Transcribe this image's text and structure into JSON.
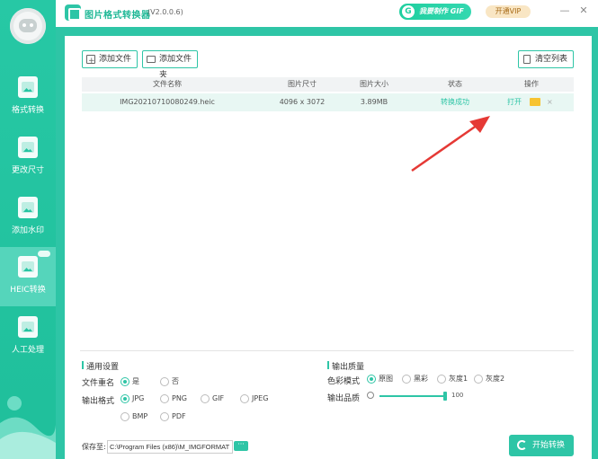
{
  "app": {
    "title": "图片格式转换器",
    "version": "(V2.0.0.6)"
  },
  "titlebar": {
    "gif_label": "我要制作 GIF",
    "gif_icon": "G",
    "vip_label": "开通VIP",
    "minimize": "—",
    "close": "✕"
  },
  "sidebar": {
    "items": [
      {
        "label": "格式转换",
        "icon": "format-convert-icon"
      },
      {
        "label": "更改尺寸",
        "icon": "resize-icon"
      },
      {
        "label": "添加水印",
        "icon": "watermark-icon"
      },
      {
        "label": "HEIC转换",
        "icon": "heic-icon",
        "active": true
      },
      {
        "label": "人工处理",
        "icon": "manual-process-icon"
      }
    ]
  },
  "toolbar": {
    "add_file": "添加文件",
    "add_folder": "添加文件夹",
    "clear_list": "清空列表"
  },
  "table": {
    "headers": [
      "文件名称",
      "图片尺寸",
      "图片大小",
      "状态",
      "操作"
    ],
    "rows": [
      {
        "name": "IMG20210710080249.heic",
        "dimensions": "4096 x 3072",
        "size": "3.89MB",
        "status": "转换成功",
        "op_open": "打开",
        "op_close": "×"
      }
    ]
  },
  "settings": {
    "general_title": "通用设置",
    "rename_label": "文件重名",
    "rename_yes": "是",
    "rename_no": "否",
    "format_label": "输出格式",
    "formats": [
      "JPG",
      "PNG",
      "GIF",
      "JPEG",
      "BMP",
      "PDF"
    ],
    "selected_format": "JPG",
    "quality_title": "输出质量",
    "color_label": "色彩模式",
    "colors": [
      "原图",
      "黑彩",
      "灰度1",
      "灰度2"
    ],
    "quality_label": "输出品质",
    "quality_value": "100"
  },
  "footer": {
    "save_label": "保存至:",
    "save_path": "C:\\Program Files (x86)\\M_IMGFORMAT",
    "browse": "···",
    "start": "开始转换"
  },
  "colors": {
    "accent": "#2ec5a6",
    "vip_bg": "#f9e6c4",
    "arrow": "#e53935"
  }
}
